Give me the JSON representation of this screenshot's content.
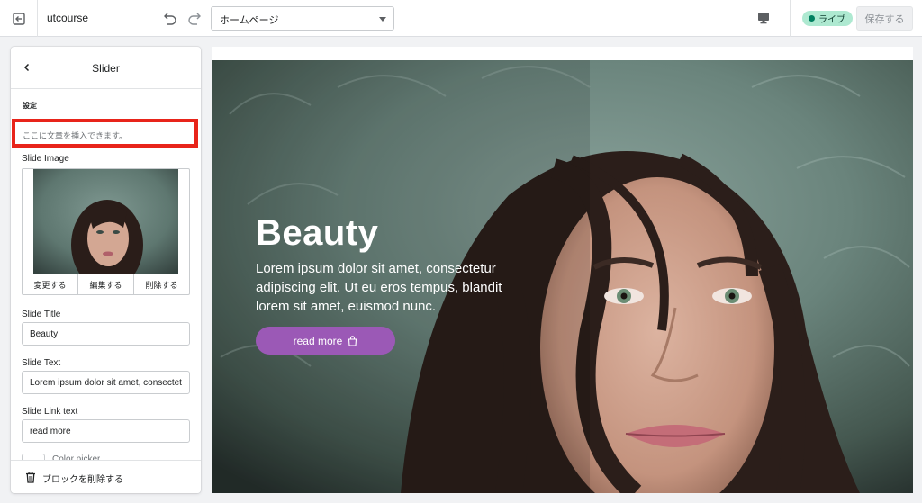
{
  "topbar": {
    "store_name": "utcourse",
    "page_select": "ホームページ",
    "live_label": "ライブ",
    "save_label": "保存する"
  },
  "sidebar": {
    "title": "Slider",
    "section_label": "設定",
    "text_insert_placeholder": "ここに文章を挿入できます。",
    "slide_image_label": "Slide Image",
    "image_actions": [
      "変更する",
      "編集する",
      "削除する"
    ],
    "slide_title_label": "Slide Title",
    "slide_title_value": "Beauty",
    "slide_text_label": "Slide Text",
    "slide_text_value": "Lorem ipsum dolor sit amet, consectetur",
    "slide_link_label": "Slide Link text",
    "slide_link_value": "read more",
    "color_picker_label": "Color picker",
    "delete_block_label": "ブロックを削除する"
  },
  "hero": {
    "title": "Beauty",
    "text": "Lorem ipsum dolor sit amet, consectetur adipiscing elit. Ut eu eros tempus, blandit lorem sit amet, euismod nunc.",
    "button_label": "read more"
  },
  "colors": {
    "accent_button": "#9b59b6",
    "highlight_border": "#e8241a",
    "live_badge_bg": "#aee9d1",
    "live_dot": "#007f5f"
  },
  "icons": {
    "exit": "exit-icon",
    "undo": "undo-icon",
    "redo": "redo-icon",
    "device": "desktop-icon",
    "back": "chevron-left-icon",
    "trash": "trash-icon",
    "button_icon": "shopping-bag-icon"
  }
}
